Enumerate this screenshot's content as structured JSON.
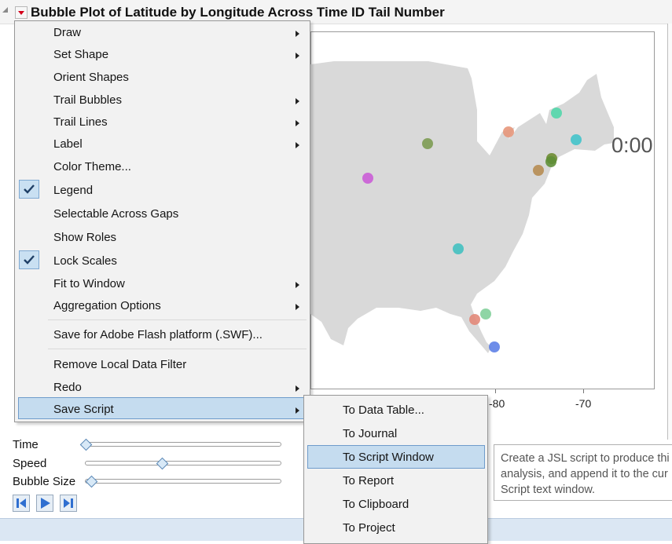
{
  "window": {
    "title": "Bubble Plot of Latitude by Longitude Across Time ID Tail Number"
  },
  "plot": {
    "timer": "0:00",
    "x_ticks": [
      "-80",
      "-70"
    ],
    "map_fill": "#d9d9d9",
    "bubbles": [
      {
        "color": "#4fd6a8"
      },
      {
        "color": "#e69477"
      },
      {
        "color": "#7a9a4e"
      },
      {
        "color": "#3fc3c9"
      },
      {
        "color": "#6b8a2f"
      },
      {
        "color": "#5d8e35"
      },
      {
        "color": "#b58a4f"
      },
      {
        "color": "#c95ad6"
      },
      {
        "color": "#3fbfbf"
      },
      {
        "color": "#7fcf99"
      },
      {
        "color": "#e38676"
      },
      {
        "color": "#5a7de6"
      }
    ]
  },
  "controls": {
    "time_label": "Time",
    "speed_label": "Speed",
    "bubble_size_label": "Bubble Size",
    "time_value": 0.0,
    "speed_value": 0.4,
    "bubble_size_value": 0.03
  },
  "main_menu": {
    "items": [
      {
        "label": "Draw",
        "submenu": true,
        "checked": false
      },
      {
        "label": "Set Shape",
        "submenu": true,
        "checked": false
      },
      {
        "label": "Orient Shapes",
        "submenu": false,
        "checked": false
      },
      {
        "label": "Trail Bubbles",
        "submenu": true,
        "checked": false
      },
      {
        "label": "Trail Lines",
        "submenu": true,
        "checked": false
      },
      {
        "label": "Label",
        "submenu": true,
        "checked": false
      },
      {
        "label": "Color Theme...",
        "submenu": false,
        "checked": false
      },
      {
        "label": "Legend",
        "submenu": false,
        "checked": true
      },
      {
        "label": "Selectable Across Gaps",
        "submenu": false,
        "checked": false
      },
      {
        "label": "Show Roles",
        "submenu": false,
        "checked": false
      },
      {
        "label": "Lock Scales",
        "submenu": false,
        "checked": true
      },
      {
        "label": "Fit to Window",
        "submenu": true,
        "checked": false
      },
      {
        "label": "Aggregation Options",
        "submenu": true,
        "checked": false
      },
      {
        "label": "Save for Adobe Flash platform (.SWF)...",
        "submenu": false,
        "checked": false
      },
      {
        "label": "Remove Local Data Filter",
        "submenu": false,
        "checked": false
      },
      {
        "label": "Redo",
        "submenu": true,
        "checked": false
      },
      {
        "label": "Save Script",
        "submenu": true,
        "checked": false,
        "highlighted": true
      }
    ]
  },
  "save_script_menu": {
    "items": [
      {
        "label": "To Data Table...",
        "highlighted": false
      },
      {
        "label": "To Journal",
        "highlighted": false
      },
      {
        "label": "To Script Window",
        "highlighted": true
      },
      {
        "label": "To Report",
        "highlighted": false
      },
      {
        "label": "To Clipboard",
        "highlighted": false
      },
      {
        "label": "To Project",
        "highlighted": false
      }
    ]
  },
  "tooltip": {
    "line1": "Create a JSL script to produce thi",
    "line2": "analysis, and append it to the cur",
    "line3": "Script text window."
  }
}
